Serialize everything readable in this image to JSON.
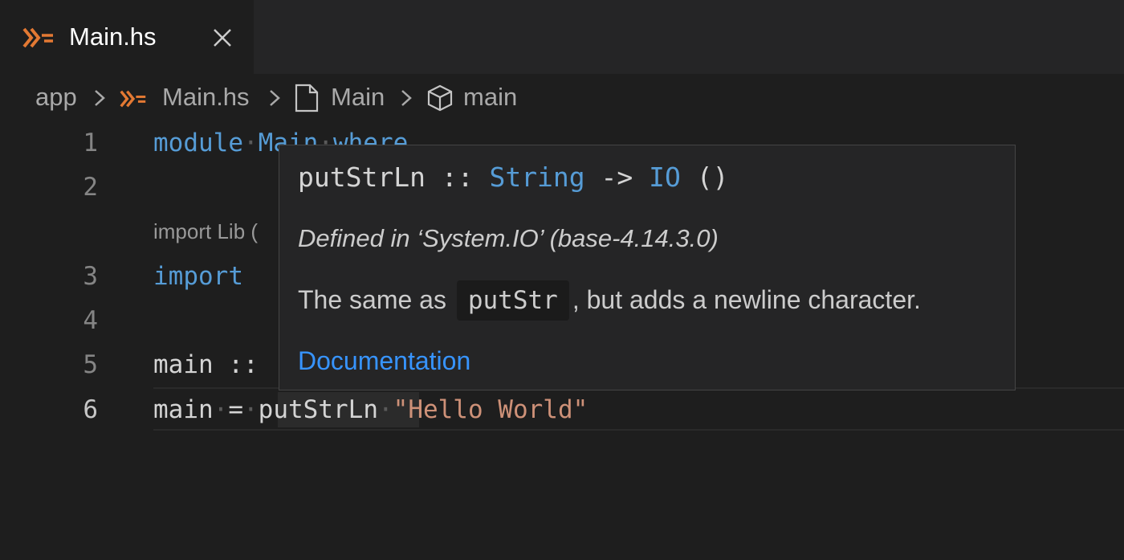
{
  "tab": {
    "label": "Main.hs",
    "close_icon": "close-icon"
  },
  "breadcrumbs": {
    "folder": "app",
    "file": "Main.hs",
    "module": "Main",
    "symbol": "main"
  },
  "editor": {
    "line_numbers": [
      "1",
      "2",
      "3",
      "4",
      "5",
      "6"
    ],
    "active_line": "6",
    "code_lens": "import Lib (",
    "line1": {
      "kw": "module",
      "name": "Main",
      "kw2": "where"
    },
    "line3": {
      "kw": "import"
    },
    "line5": {
      "text": "main ::"
    },
    "line6": {
      "lhs": "main",
      "eq": "=",
      "fn": "putStrLn",
      "str": "\"Hello World\""
    }
  },
  "hover": {
    "sig_name": "putStrLn",
    "sig_sep": "::",
    "sig_type1": "String",
    "sig_arrow": "->",
    "sig_type2": "IO",
    "sig_unit": "()",
    "defined": "Defined in ‘System.IO’ (base-4.14.3.0)",
    "desc_pre": "The same as",
    "desc_code": "putStr",
    "desc_post": ", but adds a newline character.",
    "link": "Documentation"
  },
  "colors": {
    "haskell_icon": "#e37933",
    "keyword": "#569cd6",
    "string": "#ce9178",
    "link": "#3794ff"
  }
}
